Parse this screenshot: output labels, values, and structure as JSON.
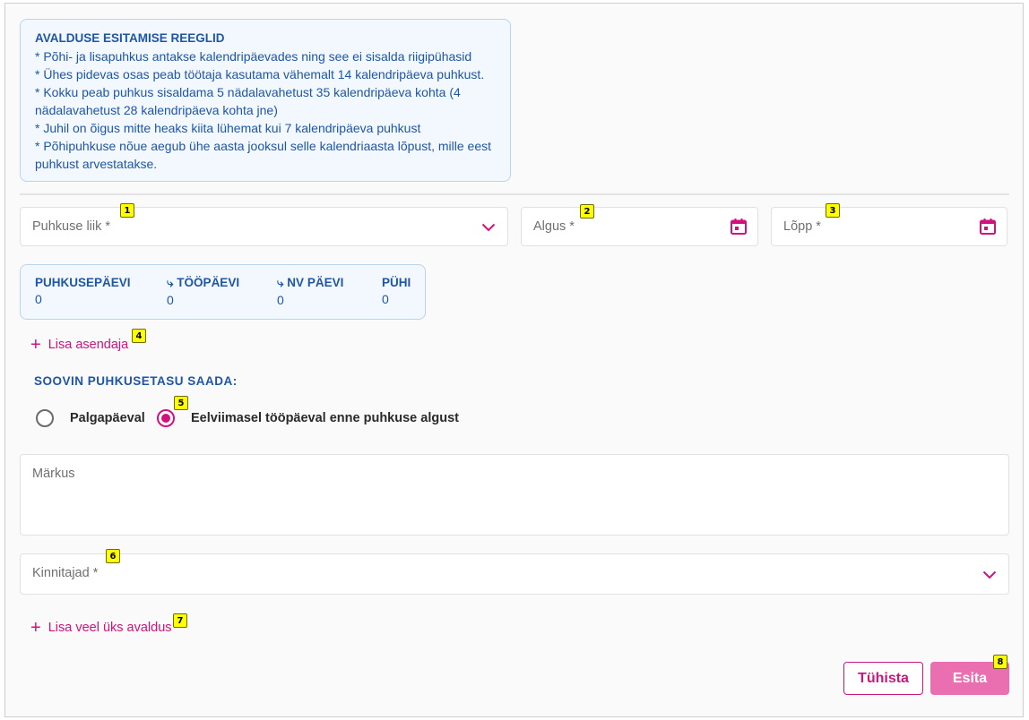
{
  "rules": {
    "title": "AVALDUSE ESITAMISE REEGLID",
    "lines": [
      "* Põhi- ja lisapuhkus antakse kalendripäevades ning see ei sisalda riigipühasid",
      "* Ühes pidevas osas peab töötaja kasutama vähemalt 14 kalendripäeva puhkust.",
      "* Kokku peab puhkus sisaldama 5 nädalavahetust 35 kalendripäeva kohta (4",
      "nädalavahetust 28 kalendripäeva kohta jne)",
      "* Juhil on õigus mitte heaks kiita lühemat kui 7 kalendripäeva puhkust",
      "* Põhipuhkuse nõue aegub ühe aasta jooksul selle kalendriaasta lõpust, mille eest",
      "puhkust arvestatakse."
    ]
  },
  "fields": {
    "leave_type": {
      "label": "Puhkuse liik *",
      "icon": "chevron-down-icon"
    },
    "start": {
      "label": "Algus *",
      "icon": "calendar-icon"
    },
    "end": {
      "label": "Lõpp *",
      "icon": "calendar-icon"
    },
    "remarks": {
      "label": "Märkus"
    },
    "approvers": {
      "label": "Kinnitajad *",
      "icon": "chevron-down-icon"
    }
  },
  "stats": [
    {
      "label": "PUHKUSEPÄEVI",
      "value": "0"
    },
    {
      "label": "⤷ TÖÖPÄEVI",
      "value": "0"
    },
    {
      "label": "⤷ NV PÄEVI",
      "value": "0"
    },
    {
      "label": "PÜHI",
      "value": "0"
    }
  ],
  "add_substitute": "Lisa asendaja",
  "pay_section": {
    "title": "SOOVIN PUHKUSETASU SAADA:",
    "options": [
      {
        "label": "Palgapäeval",
        "selected": false
      },
      {
        "label": "Eelviimasel tööpäeval enne puhkuse algust",
        "selected": true
      }
    ]
  },
  "add_another": "Lisa veel üks avaldus",
  "buttons": {
    "cancel": "Tühista",
    "submit": "Esita"
  },
  "badges": [
    "1",
    "2",
    "3",
    "4",
    "5",
    "6",
    "7",
    "8"
  ],
  "colors": {
    "accent": "#d1127e",
    "info_text": "#1e56a6",
    "info_bg": "#f3f8fe",
    "submit_bg": "#ea6fb1"
  }
}
